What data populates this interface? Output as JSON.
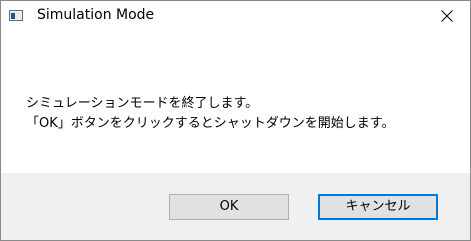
{
  "window": {
    "title": "Simulation Mode",
    "title_icon": "app-window-icon",
    "close_icon": "close-x-icon"
  },
  "message": {
    "line1": "シミュレーションモードを終了します。",
    "line2": "「OK」ボタンをクリックするとシャットダウンを開始します。"
  },
  "buttons": {
    "ok_label": "OK",
    "cancel_label": "キャンセル"
  },
  "colors": {
    "focus_border": "#0078d7",
    "footer_bg": "#f0f0f0",
    "button_bg": "#e1e1e1"
  }
}
